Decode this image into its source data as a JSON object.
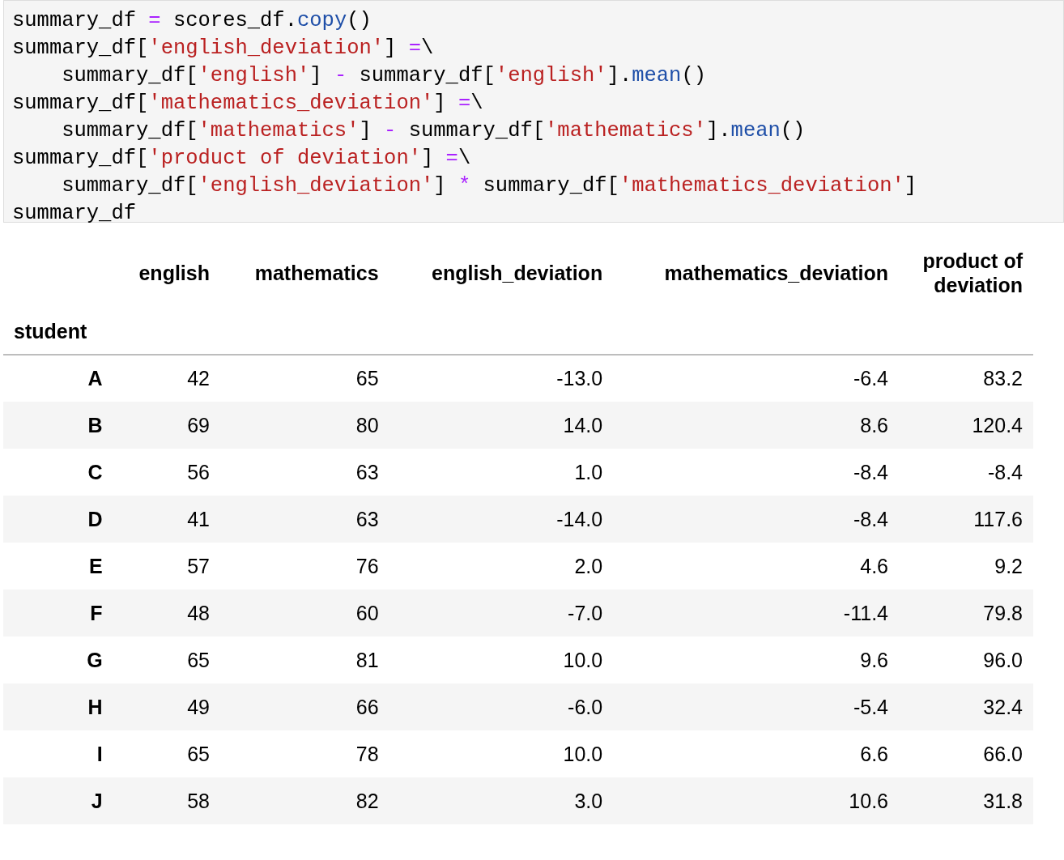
{
  "code_cell": {
    "lines": [
      [
        {
          "kind": "plain",
          "text": "summary_df "
        },
        {
          "kind": "operator",
          "text": "="
        },
        {
          "kind": "plain",
          "text": " scores_df."
        },
        {
          "kind": "function",
          "text": "copy"
        },
        {
          "kind": "plain",
          "text": "()"
        }
      ],
      [
        {
          "kind": "plain",
          "text": "summary_df["
        },
        {
          "kind": "string",
          "text": "'english_deviation'"
        },
        {
          "kind": "plain",
          "text": "] "
        },
        {
          "kind": "operator",
          "text": "="
        },
        {
          "kind": "plain",
          "text": "\\"
        }
      ],
      [
        {
          "kind": "plain",
          "text": "    summary_df["
        },
        {
          "kind": "string",
          "text": "'english'"
        },
        {
          "kind": "plain",
          "text": "] "
        },
        {
          "kind": "operator",
          "text": "-"
        },
        {
          "kind": "plain",
          "text": " summary_df["
        },
        {
          "kind": "string",
          "text": "'english'"
        },
        {
          "kind": "plain",
          "text": "]."
        },
        {
          "kind": "function",
          "text": "mean"
        },
        {
          "kind": "plain",
          "text": "()"
        }
      ],
      [
        {
          "kind": "plain",
          "text": "summary_df["
        },
        {
          "kind": "string",
          "text": "'mathematics_deviation'"
        },
        {
          "kind": "plain",
          "text": "] "
        },
        {
          "kind": "operator",
          "text": "="
        },
        {
          "kind": "plain",
          "text": "\\"
        }
      ],
      [
        {
          "kind": "plain",
          "text": "    summary_df["
        },
        {
          "kind": "string",
          "text": "'mathematics'"
        },
        {
          "kind": "plain",
          "text": "] "
        },
        {
          "kind": "operator",
          "text": "-"
        },
        {
          "kind": "plain",
          "text": " summary_df["
        },
        {
          "kind": "string",
          "text": "'mathematics'"
        },
        {
          "kind": "plain",
          "text": "]."
        },
        {
          "kind": "function",
          "text": "mean"
        },
        {
          "kind": "plain",
          "text": "()"
        }
      ],
      [
        {
          "kind": "plain",
          "text": "summary_df["
        },
        {
          "kind": "string",
          "text": "'product of deviation'"
        },
        {
          "kind": "plain",
          "text": "] "
        },
        {
          "kind": "operator",
          "text": "="
        },
        {
          "kind": "plain",
          "text": "\\"
        }
      ],
      [
        {
          "kind": "plain",
          "text": "    summary_df["
        },
        {
          "kind": "string",
          "text": "'english_deviation'"
        },
        {
          "kind": "plain",
          "text": "] "
        },
        {
          "kind": "operator",
          "text": "*"
        },
        {
          "kind": "plain",
          "text": " summary_df["
        },
        {
          "kind": "string",
          "text": "'mathematics_deviation'"
        },
        {
          "kind": "plain",
          "text": "]"
        }
      ],
      [
        {
          "kind": "plain",
          "text": "summary_df"
        }
      ]
    ]
  },
  "table": {
    "columns": [
      "english",
      "mathematics",
      "english_deviation",
      "mathematics_deviation",
      "product of deviation"
    ],
    "index_name": "student",
    "rows": [
      {
        "index": "A",
        "cells": [
          "42",
          "65",
          "-13.0",
          "-6.4",
          "83.2"
        ]
      },
      {
        "index": "B",
        "cells": [
          "69",
          "80",
          "14.0",
          "8.6",
          "120.4"
        ]
      },
      {
        "index": "C",
        "cells": [
          "56",
          "63",
          "1.0",
          "-8.4",
          "-8.4"
        ]
      },
      {
        "index": "D",
        "cells": [
          "41",
          "63",
          "-14.0",
          "-8.4",
          "117.6"
        ]
      },
      {
        "index": "E",
        "cells": [
          "57",
          "76",
          "2.0",
          "4.6",
          "9.2"
        ]
      },
      {
        "index": "F",
        "cells": [
          "48",
          "60",
          "-7.0",
          "-11.4",
          "79.8"
        ]
      },
      {
        "index": "G",
        "cells": [
          "65",
          "81",
          "10.0",
          "9.6",
          "96.0"
        ]
      },
      {
        "index": "H",
        "cells": [
          "49",
          "66",
          "-6.0",
          "-5.4",
          "32.4"
        ]
      },
      {
        "index": "I",
        "cells": [
          "65",
          "78",
          "10.0",
          "6.6",
          "66.0"
        ]
      },
      {
        "index": "J",
        "cells": [
          "58",
          "82",
          "3.0",
          "10.6",
          "31.8"
        ]
      }
    ]
  }
}
